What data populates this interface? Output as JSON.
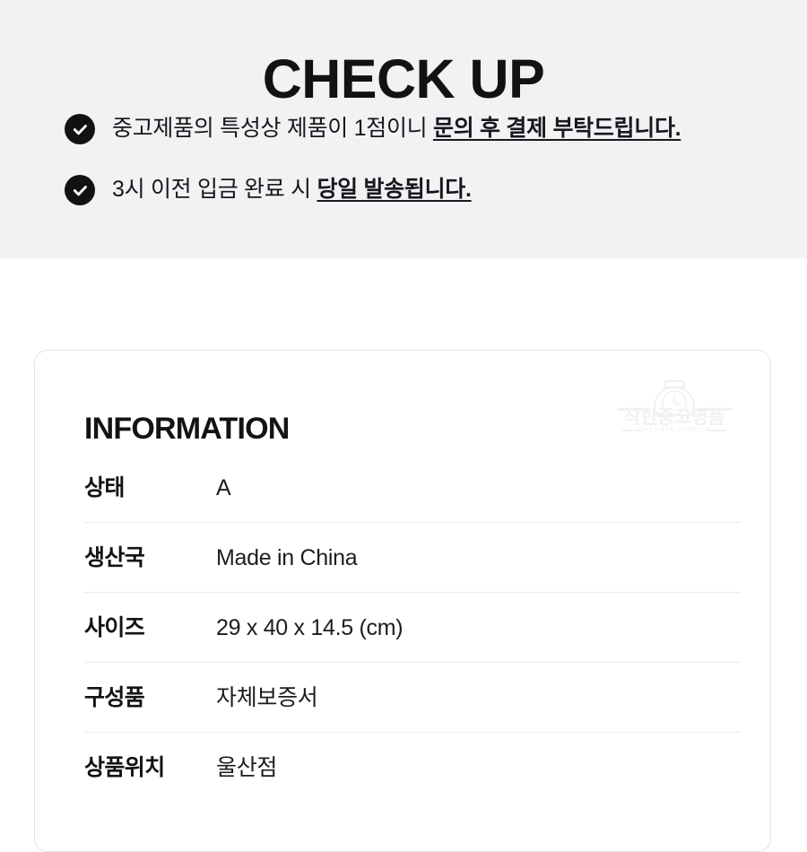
{
  "checkup": {
    "title": "CHECK UP",
    "items": [
      {
        "icon": "check-circle-icon",
        "text_plain": "중고제품의 특성상 제품이 1점이니 ",
        "text_emphasis": "문의 후 결제 부탁드립니다."
      },
      {
        "icon": "check-circle-icon",
        "text_plain": "3시 이전 입금 완료 시 ",
        "text_emphasis": "당일 발송됩니다."
      }
    ]
  },
  "information": {
    "title": "INFORMATION",
    "watermark": {
      "icon": "watch-logo-icon",
      "word": "착한중고명품",
      "sub": "CHAKHAN JUNGGO"
    },
    "rows": [
      {
        "label": "상태",
        "value": "A"
      },
      {
        "label": "생산국",
        "value": "Made in China"
      },
      {
        "label": "사이즈",
        "value": "29 x 40 x 14.5 (cm)"
      },
      {
        "label": "구성품",
        "value": "자체보증서"
      },
      {
        "label": "상품위치",
        "value": "울산점"
      }
    ]
  },
  "colors": {
    "panel_background": "#f1f2f4",
    "page_background": "#ffffff",
    "text": "#121316",
    "icon_fill": "#121212",
    "card_border": "#e4e4e6",
    "row_divider": "#ececec"
  }
}
